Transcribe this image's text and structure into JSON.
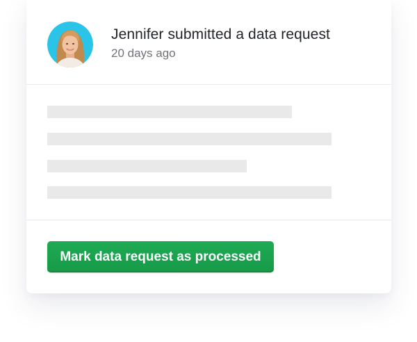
{
  "notification": {
    "user_avatar": "avatar-photo-jennifer",
    "title": "Jennifer submitted a data request",
    "time_ago": "20 days ago"
  },
  "body": {
    "placeholder_line_count": 4
  },
  "actions": {
    "primary_button_label": "Mark data request as processed",
    "primary_button_color": "#1aa14d"
  },
  "colors": {
    "avatar_ring": "#29c4e8",
    "skeleton": "#e9e9e9",
    "divider": "#e6e8eb"
  }
}
